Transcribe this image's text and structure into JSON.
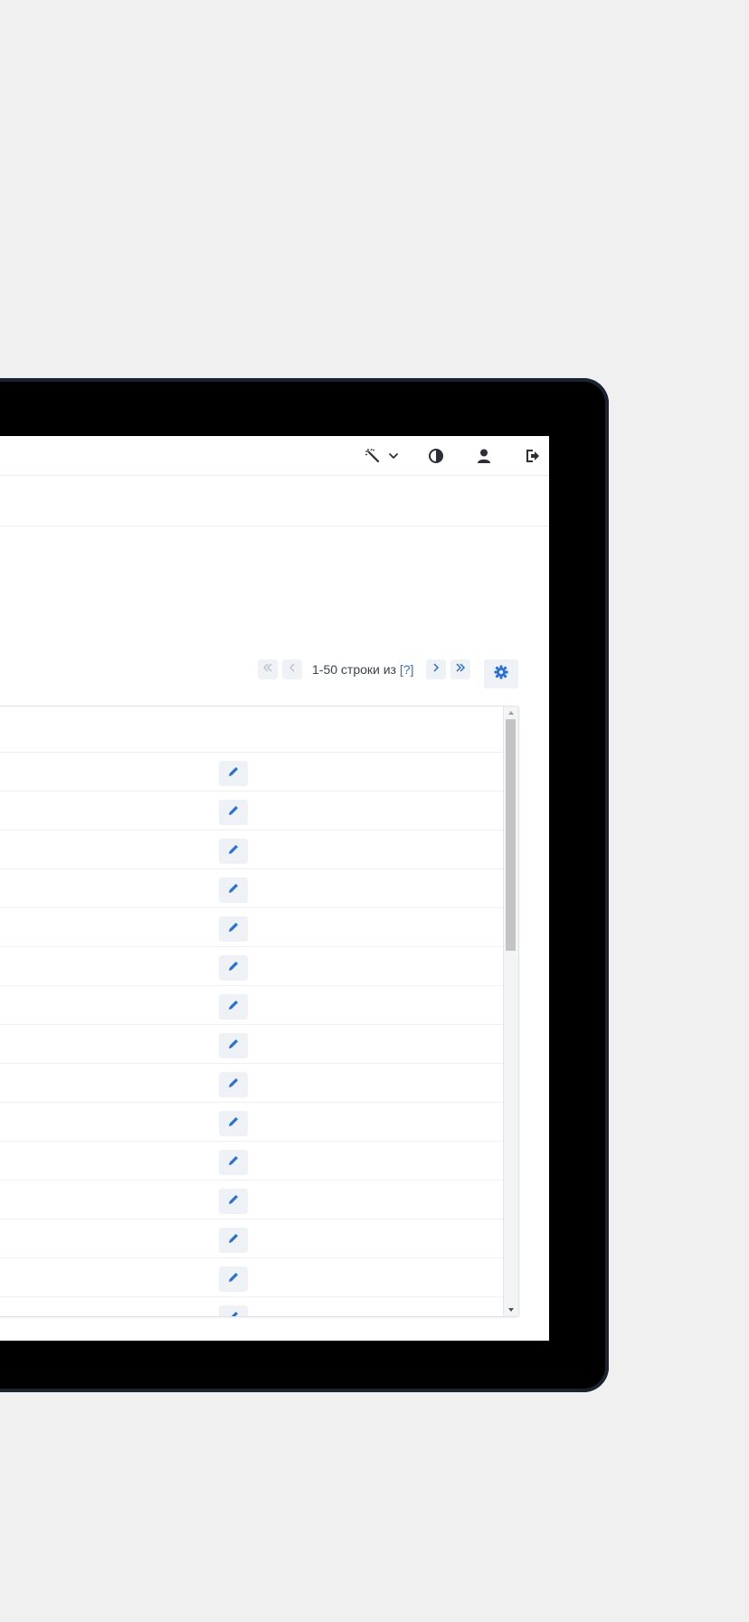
{
  "topbar": {
    "icons": [
      "magic-wand-icon",
      "chevron-down-icon",
      "contrast-icon",
      "user-icon",
      "logout-icon"
    ]
  },
  "pagination": {
    "range_text": "1-50 строки из",
    "unknown_total": "[?]",
    "icons": [
      "first-page-icon",
      "prev-page-icon",
      "next-page-icon",
      "last-page-icon",
      "gear-icon"
    ]
  },
  "grid": {
    "row_count_visible": 15,
    "row_icon": "pencil-icon"
  },
  "colors": {
    "accent": "#2a6fd6",
    "button_bg": "#eef1f5",
    "device_frame": "#000000",
    "page_bg": "#f0f0f1"
  }
}
